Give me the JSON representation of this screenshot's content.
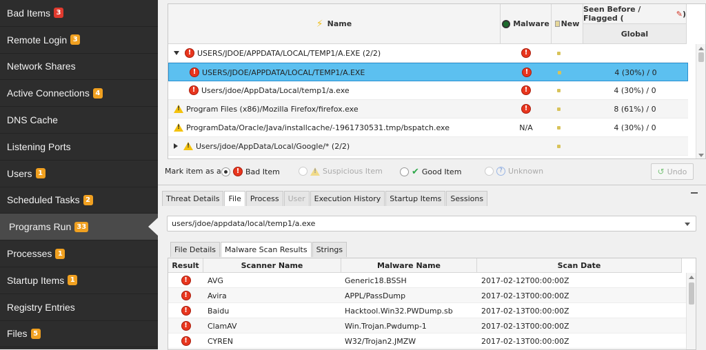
{
  "sidebar": {
    "items": [
      {
        "label": "Bad Items",
        "badge": "3",
        "badge_color": "#e03a2e"
      },
      {
        "label": "Remote Login",
        "badge": "3",
        "badge_color": "#f0a020"
      },
      {
        "label": "Network Shares",
        "badge": "",
        "badge_color": ""
      },
      {
        "label": "Active Connections",
        "badge": "4",
        "badge_color": "#f0a020"
      },
      {
        "label": "DNS Cache",
        "badge": "",
        "badge_color": ""
      },
      {
        "label": "Listening Ports",
        "badge": "",
        "badge_color": ""
      },
      {
        "label": "Users",
        "badge": "1",
        "badge_color": "#f0a020"
      },
      {
        "label": "Scheduled Tasks",
        "badge": "2",
        "badge_color": "#f0a020"
      },
      {
        "label": "Programs Run",
        "badge": "33",
        "badge_color": "#f0a020",
        "active": true
      },
      {
        "label": "Processes",
        "badge": "1",
        "badge_color": "#f0a020"
      },
      {
        "label": "Startup Items",
        "badge": "1",
        "badge_color": "#f0a020"
      },
      {
        "label": "Registry Entries",
        "badge": "",
        "badge_color": ""
      },
      {
        "label": "Files",
        "badge": "5",
        "badge_color": "#f0a020"
      }
    ]
  },
  "results": {
    "headers": {
      "name": "Name",
      "malware": "Malware",
      "new": "New",
      "seen": "Seen Before / Flagged (",
      "seen_close": ")",
      "global": "Global"
    },
    "rows": [
      {
        "indent": 0,
        "expander": "down",
        "icon": "bad",
        "name": "USERS/JDOE/APPDATA/LOCAL/TEMP1/A.EXE (2/2)",
        "malware": "bad",
        "new": true,
        "global": ""
      },
      {
        "indent": 1,
        "expander": "",
        "icon": "bad",
        "name": "USERS/JDOE/APPDATA/LOCAL/TEMP1/A.EXE",
        "malware": "bad",
        "new": true,
        "global": "4 (30%) / 0",
        "selected": true
      },
      {
        "indent": 1,
        "expander": "",
        "icon": "bad",
        "name": "Users/jdoe/AppData/Local/temp1/a.exe",
        "malware": "bad",
        "new": true,
        "global": "4 (30%) / 0"
      },
      {
        "indent": 0,
        "expander": "",
        "icon": "warn",
        "name": "Program Files (x86)/Mozilla Firefox/firefox.exe",
        "malware": "bad",
        "new": true,
        "global": "8 (61%) / 0"
      },
      {
        "indent": 0,
        "expander": "",
        "icon": "warn",
        "name": "ProgramData/Oracle/Java/installcache/-1961730531.tmp/bspatch.exe",
        "malware": "N/A",
        "new": true,
        "global": "4 (30%) / 0"
      },
      {
        "indent": 0,
        "expander": "right",
        "icon": "warn",
        "name": "Users/jdoe/AppData/Local/Google/* (2/2)",
        "malware": "",
        "new": true,
        "global": ""
      }
    ]
  },
  "markbar": {
    "prefix": "Mark item as a",
    "bad": "Bad Item",
    "suspicious": "Suspicious Item",
    "good": "Good Item",
    "unknown": "Unknown",
    "undo": "Undo"
  },
  "detail": {
    "tabs": [
      "Threat Details",
      "File",
      "Process",
      "User",
      "Execution History",
      "Startup Items",
      "Sessions"
    ],
    "active_tab": "File",
    "file_path": "users/jdoe/appdata/local/temp1/a.exe",
    "subtabs": [
      "File Details",
      "Malware Scan Results",
      "Strings"
    ],
    "active_subtab": "Malware Scan Results",
    "scan_headers": {
      "result": "Result",
      "scanner": "Scanner Name",
      "malware": "Malware Name",
      "date": "Scan Date"
    },
    "scan_rows": [
      {
        "scanner": "AVG",
        "malware": "Generic18.BSSH",
        "date": "2017-02-12T00:00:00Z"
      },
      {
        "scanner": "Avira",
        "malware": "APPL/PassDump",
        "date": "2017-02-13T00:00:00Z"
      },
      {
        "scanner": "Baidu",
        "malware": "Hacktool.Win32.PWDump.sb",
        "date": "2017-02-13T00:00:00Z"
      },
      {
        "scanner": "ClamAV",
        "malware": "Win.Trojan.Pwdump-1",
        "date": "2017-02-13T00:00:00Z"
      },
      {
        "scanner": "CYREN",
        "malware": "W32/Trojan2.JMZW",
        "date": "2017-02-13T00:00:00Z"
      }
    ]
  }
}
